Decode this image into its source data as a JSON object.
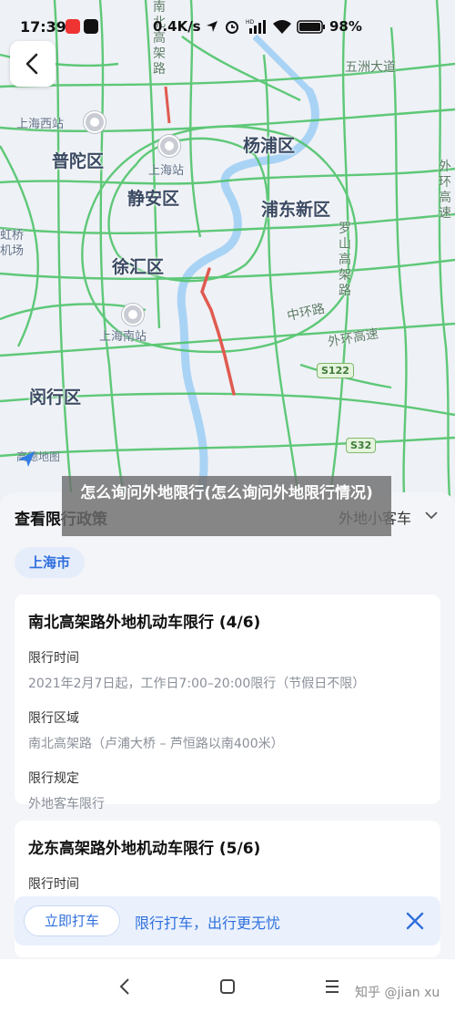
{
  "status_bar": {
    "time": "17:39",
    "network_speed": "0.4K/s",
    "battery": "98%",
    "icons": [
      "notification-app-icon",
      "douyin-icon",
      "location-icon",
      "alarm-icon",
      "hd-icon",
      "signal-icon",
      "wifi-icon",
      "battery-icon"
    ]
  },
  "map": {
    "districts": [
      "普陀区",
      "静安区",
      "杨浦区",
      "浦东新区",
      "徐汇区",
      "闵行区"
    ],
    "pois": [
      "上海西站",
      "上海站",
      "上海南站",
      "虹桥机场"
    ],
    "roads": [
      "南北高架路",
      "五洲大道",
      "中环路",
      "外环高速",
      "罗山高架路",
      "外环高速",
      "闵行区"
    ],
    "shields": [
      "S122",
      "S32"
    ],
    "logo": "高德地图",
    "route_color": "#e05a4f",
    "road_color": "#4fc46a",
    "river_color": "#a9d3f5"
  },
  "overlay_title": "怎么询问外地限行(怎么询问外地限行情况)",
  "panel": {
    "title": "查看限行政策",
    "vehicle_type": "外地小客车",
    "city": "上海市",
    "cards": [
      {
        "title": "南北高架路外地机动车限行 (4/6)",
        "time_label": "限行时间",
        "time_value": "2021年2月7日起，工作日7:00–20:00限行（节假日不限）",
        "area_label": "限行区域",
        "area_value": "南北高架路（卢浦大桥 – 芦恒路以南400米）",
        "rule_label": "限行规定",
        "rule_value": "外地客车限行"
      },
      {
        "title": "龙东高架路外地机动车限行 (5/6)",
        "time_label": "限行时间"
      }
    ]
  },
  "promo": {
    "button": "立即打车",
    "text": "限行打车，出行更无忧"
  },
  "watermark": "知乎 @jian xu",
  "accent_color": "#2f6fdd"
}
